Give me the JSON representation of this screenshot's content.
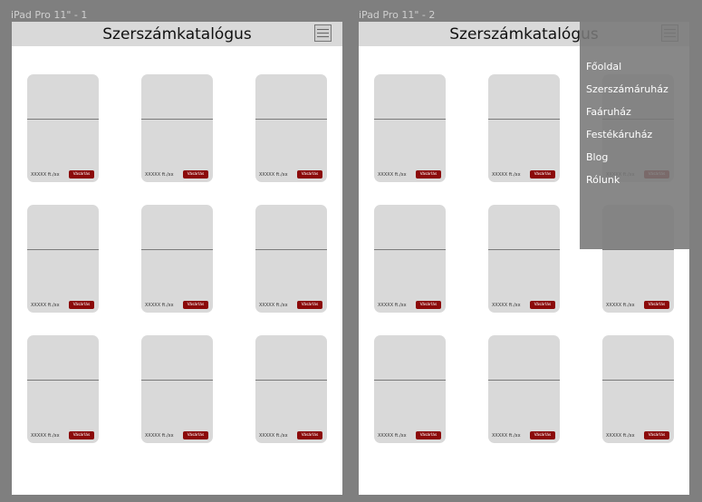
{
  "frames": [
    {
      "label": "iPad Pro 11\" - 1",
      "title": "Szerszámkatalógus",
      "menu_open": false
    },
    {
      "label": "iPad Pro 11\" - 2",
      "title": "Szerszámkatalógus",
      "menu_open": true
    }
  ],
  "card": {
    "price": "XXXXX ft./xx",
    "buy_label": "Vásárlás"
  },
  "menu": {
    "items": [
      "Főoldal",
      "Szerszámáruház",
      "Faáruház",
      "Festékáruház",
      "Blog",
      "Rólunk"
    ]
  },
  "colors": {
    "canvas": "#7f7f7f",
    "header": "#d9d9d9",
    "card": "#d9d9d9",
    "buy_button": "#8b0a0a",
    "menu_overlay": "#787878"
  },
  "icons": {
    "menu_toggle": "hamburger-icon"
  }
}
